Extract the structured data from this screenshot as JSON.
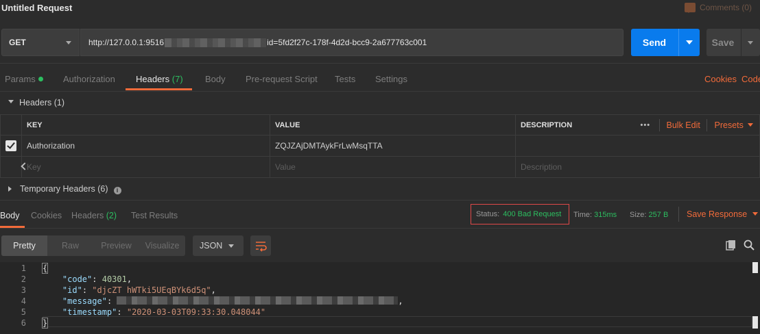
{
  "window": {
    "title": "Untitled Request",
    "comments_label": "Comments (0)"
  },
  "request": {
    "method": "GET",
    "url_prefix": "http://127.0.0.1:9516",
    "url_suffix": "id=5fd2f27c-178f-4d2d-bcc9-2a677763c001",
    "send_label": "Send",
    "save_label": "Save"
  },
  "request_tabs": [
    {
      "label": "Params",
      "count": ""
    },
    {
      "label": "Authorization",
      "count": ""
    },
    {
      "label": "Headers",
      "count": "(7)"
    },
    {
      "label": "Body",
      "count": ""
    },
    {
      "label": "Pre-request Script",
      "count": ""
    },
    {
      "label": "Tests",
      "count": ""
    },
    {
      "label": "Settings",
      "count": ""
    }
  ],
  "request_links": {
    "cookies": "Cookies",
    "code": "Code"
  },
  "headers_section": {
    "title": "Headers (1)",
    "columns": {
      "key": "KEY",
      "value": "VALUE",
      "description": "DESCRIPTION"
    },
    "more": "•••",
    "bulk_edit": "Bulk Edit",
    "presets": "Presets",
    "rows": [
      {
        "checked": true,
        "key": "Authorization",
        "value": "ZQJZAjDMTAykFrLwMsqTTA",
        "description": ""
      }
    ],
    "placeholder": {
      "key": "Key",
      "value": "Value",
      "description": "Description"
    },
    "temporary": "Temporary Headers (6)"
  },
  "response_tabs": [
    {
      "label": "Body",
      "count": ""
    },
    {
      "label": "Cookies",
      "count": ""
    },
    {
      "label": "Headers",
      "count": "(2)"
    },
    {
      "label": "Test Results",
      "count": ""
    }
  ],
  "response_meta": {
    "status_label": "Status:",
    "status_value": "400 Bad Request",
    "time_label": "Time:",
    "time_value": "315ms",
    "size_label": "Size:",
    "size_value": "257 B",
    "save_response": "Save Response"
  },
  "format": {
    "modes": [
      "Pretty",
      "Raw",
      "Preview",
      "Visualize"
    ],
    "language": "JSON"
  },
  "body": {
    "line_numbers": [
      "1",
      "2",
      "3",
      "4",
      "5",
      "6"
    ],
    "open": "{",
    "close": "}",
    "code_key": "\"code\"",
    "code_value": "40301",
    "id_key": "\"id\"",
    "id_value": "\"djcZT hWTki5UEqBYk6d5q\"",
    "message_key": "\"message\"",
    "timestamp_key": "\"timestamp\"",
    "timestamp_value": "\"2020-03-03T09:33:30.048044\""
  },
  "colors": {
    "accent": "#f26b3a",
    "send": "#097bed",
    "success": "#2cbe60",
    "error_border": "#e04949"
  }
}
